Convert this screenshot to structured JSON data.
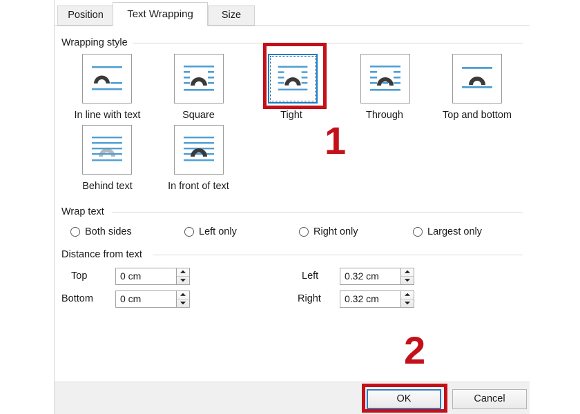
{
  "dialog": {
    "tabs": [
      {
        "id": "position",
        "label": "Position",
        "selected": false
      },
      {
        "id": "textwrapping",
        "label": "Text Wrapping",
        "selected": true
      },
      {
        "id": "size",
        "label": "Size",
        "selected": false
      }
    ]
  },
  "wrapping_style": {
    "group_label": "Wrapping style",
    "selected": "tight",
    "options": [
      {
        "id": "inline",
        "label": "In line with text",
        "icon": "wrap-inline-icon",
        "selected": false
      },
      {
        "id": "square",
        "label": "Square",
        "icon": "wrap-square-icon",
        "selected": false
      },
      {
        "id": "tight",
        "label": "Tight",
        "icon": "wrap-tight-icon",
        "selected": true
      },
      {
        "id": "through",
        "label": "Through",
        "icon": "wrap-through-icon",
        "selected": false
      },
      {
        "id": "topbottom",
        "label": "Top and bottom",
        "icon": "wrap-topbottom-icon",
        "selected": false
      },
      {
        "id": "behind",
        "label": "Behind text",
        "icon": "wrap-behind-icon",
        "selected": false
      },
      {
        "id": "infront",
        "label": "In front of text",
        "icon": "wrap-infront-icon",
        "selected": false
      }
    ]
  },
  "wrap_text": {
    "group_label": "Wrap text",
    "options": [
      {
        "id": "both",
        "label": "Both sides",
        "checked": false
      },
      {
        "id": "left",
        "label": "Left only",
        "checked": false
      },
      {
        "id": "right",
        "label": "Right only",
        "checked": false
      },
      {
        "id": "largest",
        "label": "Largest only",
        "checked": false
      }
    ]
  },
  "distance_from_text": {
    "group_label": "Distance from text",
    "fields": [
      {
        "id": "top",
        "label": "Top",
        "value": "0 cm"
      },
      {
        "id": "bottom",
        "label": "Bottom",
        "value": "0 cm"
      },
      {
        "id": "left",
        "label": "Left",
        "value": "0.32 cm"
      },
      {
        "id": "right",
        "label": "Right",
        "value": "0.32 cm"
      }
    ]
  },
  "footer": {
    "ok_label": "OK",
    "cancel_label": "Cancel"
  },
  "annotations": {
    "color": "#c41119",
    "step1": "1",
    "step2": "2"
  }
}
